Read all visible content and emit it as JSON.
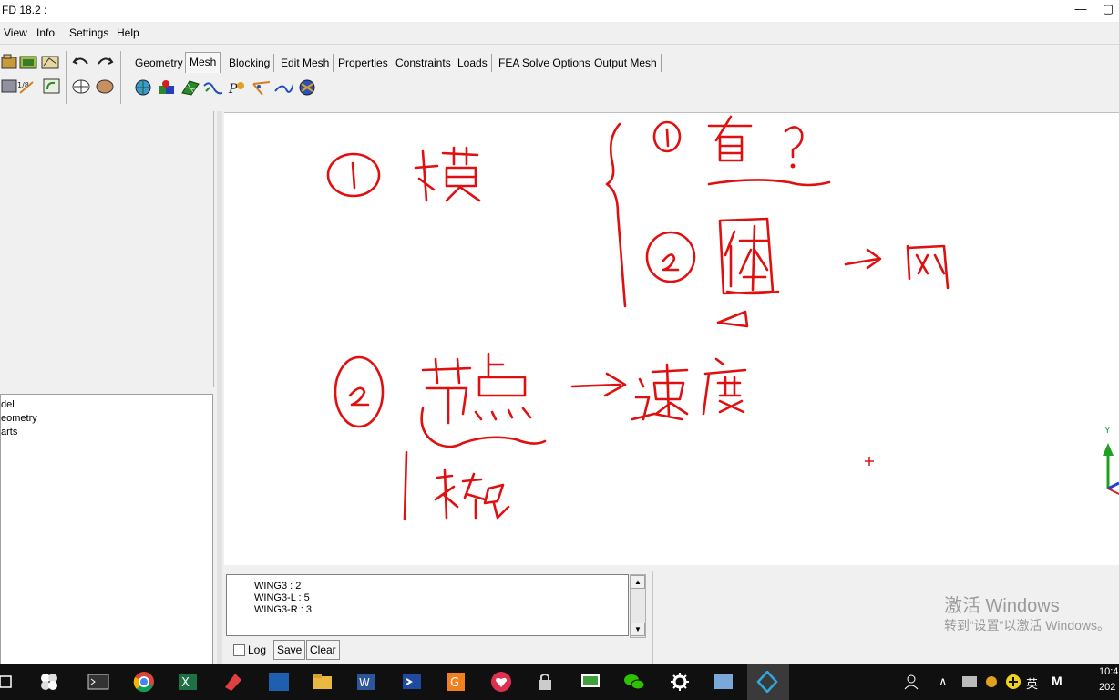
{
  "window": {
    "title": "FD 18.2 :"
  },
  "menu": [
    "View",
    "Info",
    "Settings",
    "Help"
  ],
  "tabs": [
    "Geometry",
    "Mesh",
    "Blocking",
    "Edit Mesh",
    "Properties",
    "Constraints",
    "Loads",
    "FEA Solve Options",
    "Output Mesh"
  ],
  "active_tab": "Mesh",
  "tree": [
    "del",
    "eometry",
    "arts"
  ],
  "messages": [
    "WING3 : 2",
    "WING3-L : 5",
    "WING3-R : 3"
  ],
  "controls": {
    "log": "Log",
    "save": "Save",
    "clear": "Clear"
  },
  "watermark": {
    "line1": "激活 Windows",
    "line2": "转到“设置”以激活 Windows。"
  },
  "axis": {
    "y_label": "Y"
  },
  "taskbar": {
    "lang": "英",
    "ime": "M",
    "time": "10:4",
    "date": "202"
  },
  "colors": {
    "ink": "#e01010",
    "canvas": "#ffffff",
    "taskbar": "#101010"
  }
}
